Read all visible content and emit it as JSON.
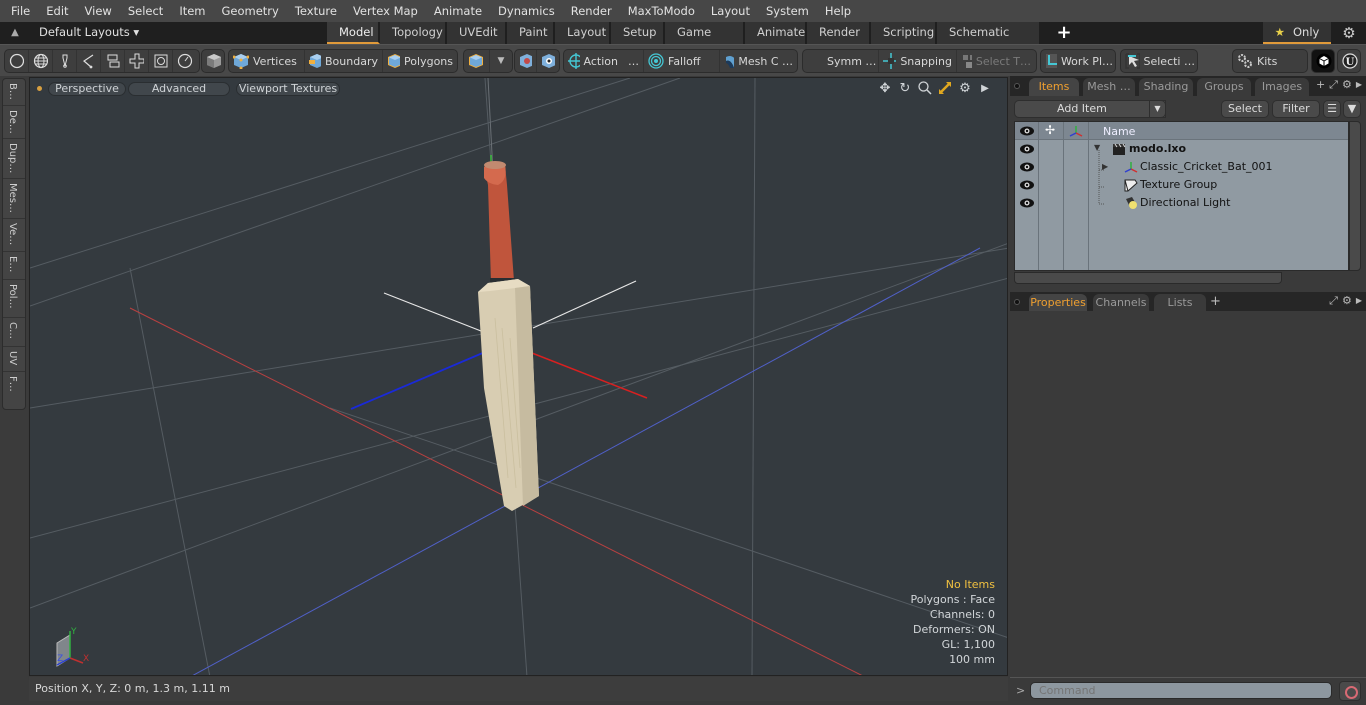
{
  "menubar": {
    "items": [
      "File",
      "Edit",
      "View",
      "Select",
      "Item",
      "Geometry",
      "Texture",
      "Vertex Map",
      "Animate",
      "Dynamics",
      "Render",
      "MaxToModo",
      "Layout",
      "System",
      "Help"
    ]
  },
  "tabbar": {
    "layouts_label": "Default Layouts ▾",
    "tabs": [
      "Model",
      "Topology",
      "UVEdit",
      "Paint",
      "Layout",
      "Setup",
      "Game Tools",
      "Animate",
      "Render",
      "Scripting",
      "Schematic Fusion"
    ],
    "active_tab": "Model",
    "add_tab": "+",
    "only_label": "Only",
    "accent_color": "#e09a3a"
  },
  "toolbar": {
    "vertices": "Vertices",
    "boundary": "Boundary",
    "polygons": "Polygons",
    "action": "Action",
    "action_more": "…",
    "falloff": "Falloff",
    "mesh_c": "Mesh C …",
    "symm": "Symm …",
    "snapping": "Snapping",
    "select_t": "Select T…",
    "work_pl": "Work Pl…",
    "selecti": "Selecti …",
    "kits": "Kits"
  },
  "left_tabs": [
    "B…",
    "De…",
    "Dup…",
    "Mes…",
    "Ve…",
    "E…",
    "Pol…",
    "C…",
    "UV",
    "F…"
  ],
  "viewport": {
    "view_mode": "Perspective",
    "shading": "Advanced",
    "textures": "Viewport Textures",
    "info": {
      "selection": "No Items",
      "polygons": "Polygons : Face",
      "channels": "Channels: 0",
      "deformers": "Deformers: ON",
      "gl": "GL: 1,100",
      "grid": "100 mm"
    },
    "axis_labels": {
      "x": "X",
      "y": "Y",
      "z": "Z"
    }
  },
  "statusbar": {
    "position": "Position X, Y, Z:   0 m, 1.3 m, 1.11 m"
  },
  "items_panel": {
    "tabs": [
      "Items",
      "Mesh …",
      "Shading",
      "Groups",
      "Images"
    ],
    "active_tab": "Items",
    "add_item": "Add Item",
    "select": "Select",
    "filter": "Filter",
    "column_name": "Name",
    "tree": [
      {
        "label": "modo.lxo",
        "type": "scene",
        "expanded": true,
        "bold": true
      },
      {
        "label": "Classic_Cricket_Bat_001",
        "type": "mesh-locator",
        "expanded": false
      },
      {
        "label": "Texture Group",
        "type": "texture-group"
      },
      {
        "label": "Directional Light",
        "type": "light"
      }
    ]
  },
  "properties_panel": {
    "tabs": [
      "Properties",
      "Channels",
      "Lists"
    ],
    "active_tab": "Properties",
    "add_tab": "+"
  },
  "command": {
    "prompt": ">",
    "placeholder": "Command"
  }
}
